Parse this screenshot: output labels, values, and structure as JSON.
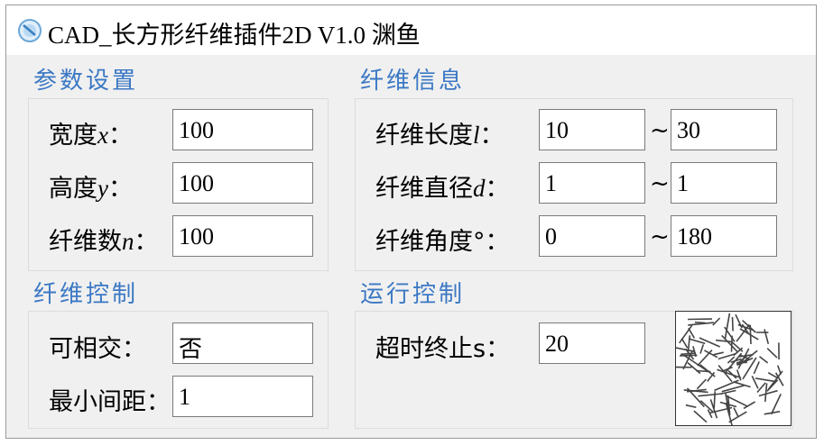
{
  "window": {
    "title": "CAD_长方形纤维插件2D V1.0 渊鱼",
    "icon": "app-icon"
  },
  "params": {
    "section_title": "参数设置",
    "width": {
      "label": "宽度",
      "var": "x",
      "value": "100"
    },
    "height": {
      "label": "高度",
      "var": "y",
      "value": "100"
    },
    "count": {
      "label": "纤维数",
      "var": "n",
      "value": "100"
    }
  },
  "fiber_info": {
    "section_title": "纤维信息",
    "length": {
      "label": "纤维长度",
      "var": "l",
      "min": "10",
      "max": "30"
    },
    "diameter": {
      "label": "纤维直径",
      "var": "d",
      "min": "1",
      "max": "1"
    },
    "angle": {
      "label": "纤维角度°",
      "min": "0",
      "max": "180"
    },
    "range_sep": "~",
    "colon": "："
  },
  "fiber_control": {
    "section_title": "纤维控制",
    "intersect": {
      "label": "可相交：",
      "value": "否"
    },
    "min_spacing": {
      "label": "最小间距：",
      "value": "1"
    }
  },
  "run_control": {
    "section_title": "运行控制",
    "timeout": {
      "label": "超时终止s：",
      "value": "20"
    }
  },
  "preview": {
    "name": "fiber-preview",
    "stroke_color": "#444444"
  }
}
